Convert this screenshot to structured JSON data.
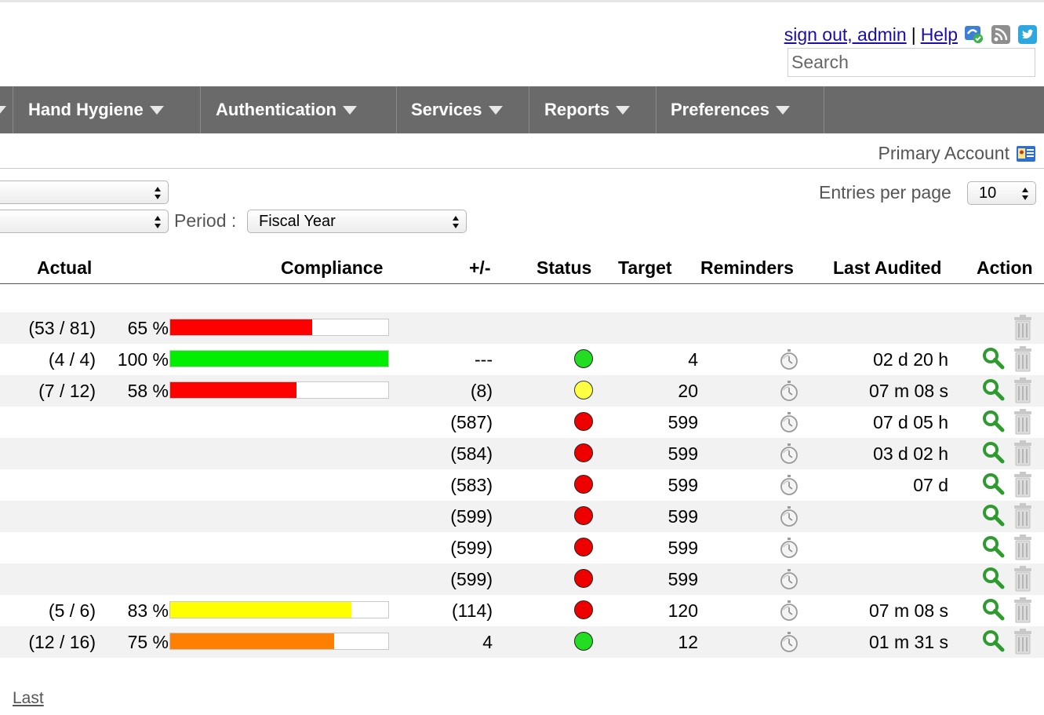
{
  "header": {
    "sign_out": "sign out, admin",
    "separator": "|",
    "help": "Help",
    "icons": [
      "hand-hygiene-badge-icon",
      "rss-icon",
      "twitter-icon"
    ],
    "search_placeholder": "Search"
  },
  "nav": {
    "items": [
      {
        "label": "Hand Hygiene"
      },
      {
        "label": "Authentication"
      },
      {
        "label": "Services"
      },
      {
        "label": "Reports"
      },
      {
        "label": "Preferences"
      }
    ]
  },
  "account": {
    "label": "Primary Account"
  },
  "filters": {
    "period_label": "Period :",
    "period_value": "Fiscal Year",
    "entries_label": "Entries per page",
    "entries_value": "10"
  },
  "table": {
    "headers": {
      "actual": "Actual",
      "compliance": "Compliance",
      "delta": "+/-",
      "status": "Status",
      "target": "Target",
      "reminders": "Reminders",
      "last_audited": "Last Audited",
      "action": "Action"
    },
    "rows": [
      {
        "actual": "(53 / 81)",
        "pct": "65 %",
        "fill": 0.65,
        "bar_color": "#ff0000",
        "delta": "",
        "status": "",
        "target": "",
        "reminder": false,
        "last": "",
        "view": false
      },
      {
        "actual": "(4 / 4)",
        "pct": "100 %",
        "fill": 1.0,
        "bar_color": "#00ee00",
        "delta": "---",
        "status": "green",
        "target": "4",
        "reminder": true,
        "last": "02 d 20 h",
        "view": true
      },
      {
        "actual": "(7 / 12)",
        "pct": "58 %",
        "fill": 0.58,
        "bar_color": "#ff0000",
        "delta": "(8)",
        "status": "yellow",
        "target": "20",
        "reminder": true,
        "last": "07 m 08 s",
        "view": true
      },
      {
        "actual": "",
        "pct": "",
        "fill": null,
        "bar_color": "",
        "delta": "(587)",
        "status": "red",
        "target": "599",
        "reminder": true,
        "last": "07 d 05 h",
        "view": true
      },
      {
        "actual": "",
        "pct": "",
        "fill": null,
        "bar_color": "",
        "delta": "(584)",
        "status": "red",
        "target": "599",
        "reminder": true,
        "last": "03 d 02 h",
        "view": true
      },
      {
        "actual": "",
        "pct": "",
        "fill": null,
        "bar_color": "",
        "delta": "(583)",
        "status": "red",
        "target": "599",
        "reminder": true,
        "last": "07 d",
        "view": true
      },
      {
        "actual": "",
        "pct": "",
        "fill": null,
        "bar_color": "",
        "delta": "(599)",
        "status": "red",
        "target": "599",
        "reminder": true,
        "last": "",
        "view": true
      },
      {
        "actual": "",
        "pct": "",
        "fill": null,
        "bar_color": "",
        "delta": "(599)",
        "status": "red",
        "target": "599",
        "reminder": true,
        "last": "",
        "view": true
      },
      {
        "actual": "",
        "pct": "",
        "fill": null,
        "bar_color": "",
        "delta": "(599)",
        "status": "red",
        "target": "599",
        "reminder": true,
        "last": "",
        "view": true
      },
      {
        "actual": "(5 / 6)",
        "pct": "83 %",
        "fill": 0.83,
        "bar_color": "#ffff00",
        "delta": "(114)",
        "status": "red",
        "target": "120",
        "reminder": true,
        "last": "07 m 08 s",
        "view": true
      },
      {
        "actual": "(12 / 16)",
        "pct": "75 %",
        "fill": 0.75,
        "bar_color": "#ff8000",
        "delta": "4",
        "status": "green",
        "target": "12",
        "reminder": true,
        "last": "01 m 31 s",
        "view": true
      }
    ]
  },
  "status_colors": {
    "green": "#22dd22",
    "yellow": "#ffff44",
    "red": "#ee0000"
  },
  "pagination": {
    "last": "Last"
  }
}
